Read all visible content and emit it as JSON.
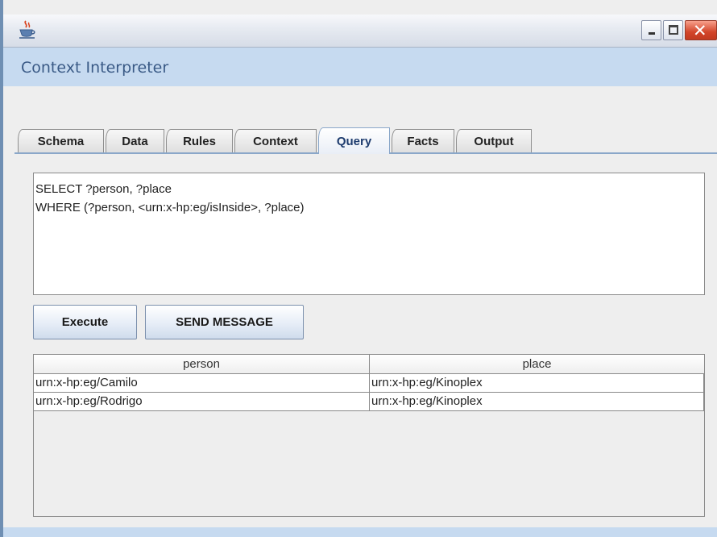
{
  "window": {
    "app_icon": "java-coffee-cup-icon",
    "controls": {
      "minimize_icon": "minimize-icon",
      "maximize_icon": "maximize-icon",
      "close_icon": "close-icon",
      "close_glyph": "✕"
    }
  },
  "header": {
    "title": "Context Interpreter"
  },
  "tabs": [
    {
      "label": "Schema",
      "active": false
    },
    {
      "label": "Data",
      "active": false
    },
    {
      "label": "Rules",
      "active": false
    },
    {
      "label": "Context",
      "active": false
    },
    {
      "label": "Query",
      "active": true
    },
    {
      "label": "Facts",
      "active": false
    },
    {
      "label": "Output",
      "active": false
    }
  ],
  "query": {
    "lines": [
      "SELECT ?person, ?place",
      "WHERE (?person, <urn:x-hp:eg/isInside>, ?place)"
    ]
  },
  "buttons": {
    "execute": "Execute",
    "send_message": "SEND MESSAGE"
  },
  "results": {
    "columns": [
      "person",
      "place"
    ],
    "rows": [
      [
        "urn:x-hp:eg/Camilo",
        "urn:x-hp:eg/Kinoplex"
      ],
      [
        "urn:x-hp:eg/Rodrigo",
        "urn:x-hp:eg/Kinoplex"
      ]
    ]
  },
  "colors": {
    "header_band": "#c6daf0",
    "header_text": "#3a5a86",
    "close_button": "#d2452a"
  }
}
